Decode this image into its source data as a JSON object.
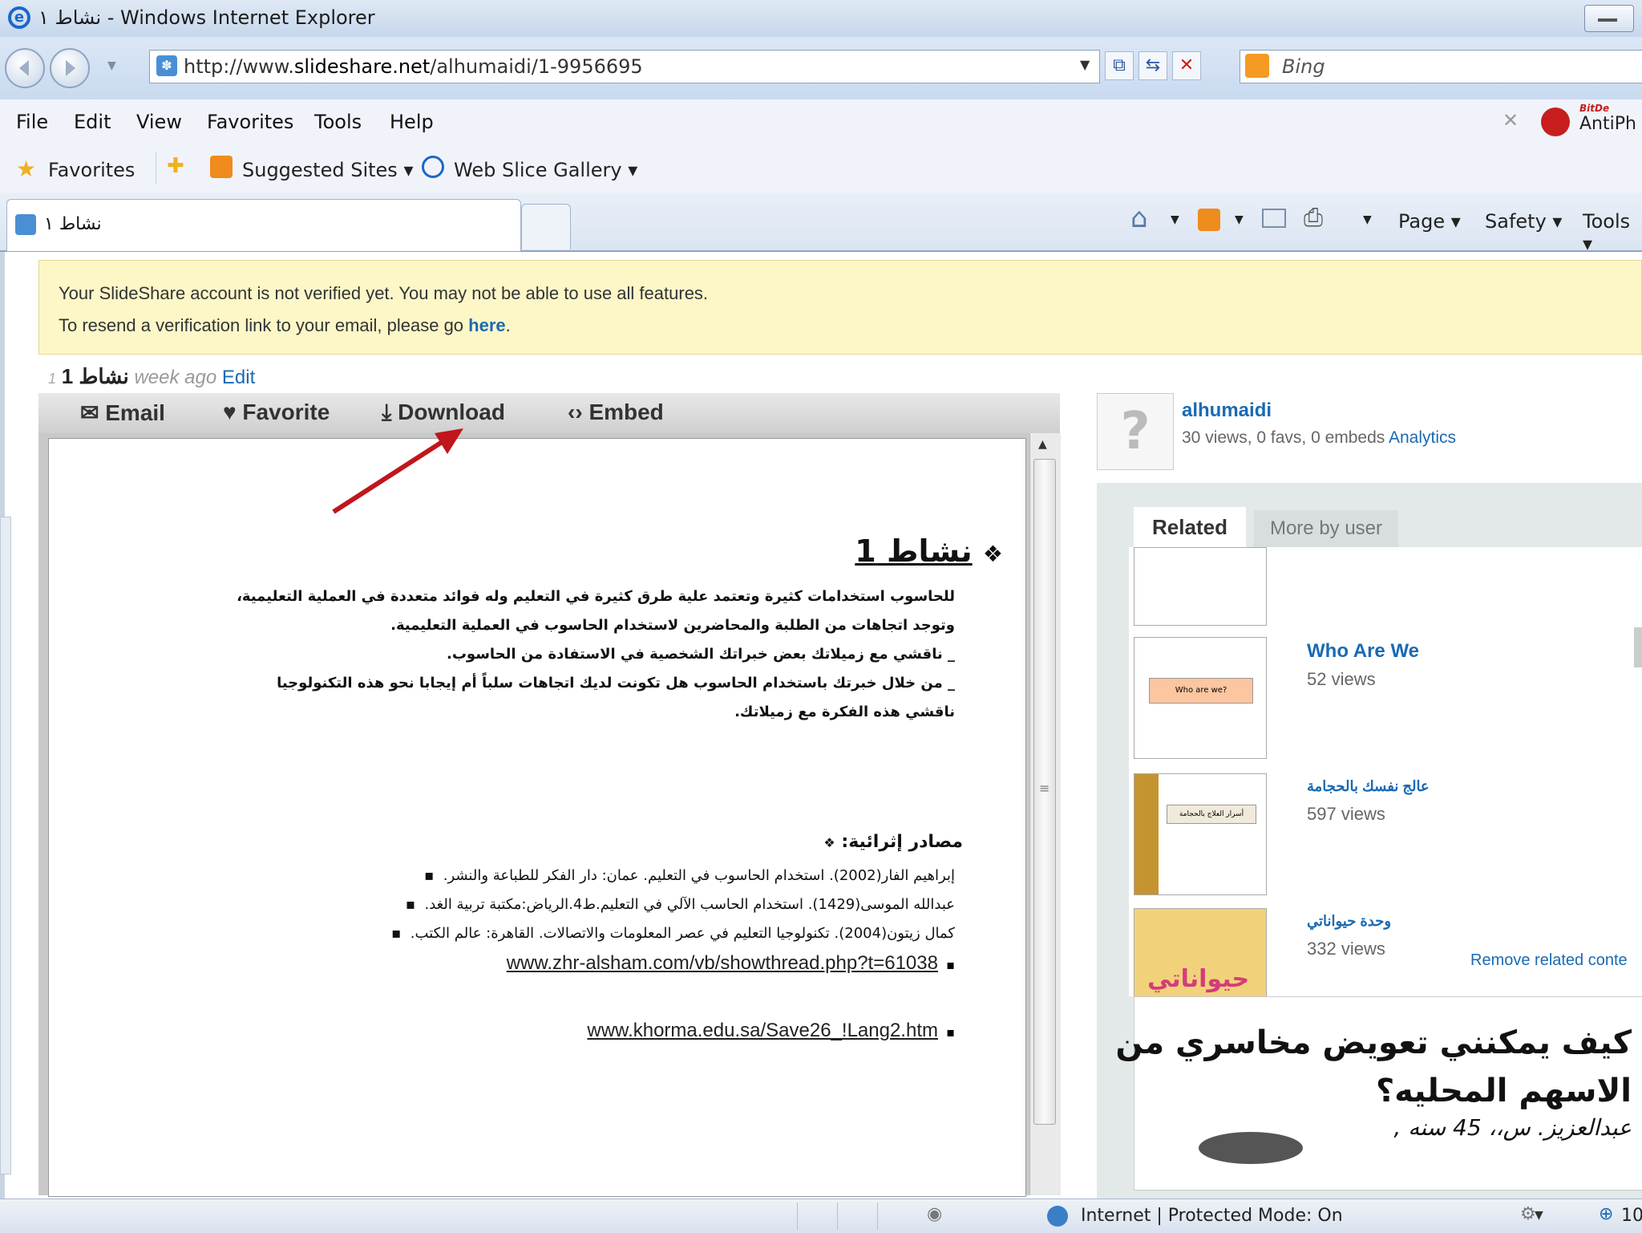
{
  "window": {
    "title": "نشاط ١ - Windows Internet Explorer"
  },
  "navbar": {
    "url_prefix": "http://www.",
    "url_domain": "slideshare.net",
    "url_path": "/alhumaidi/1-9956695",
    "search_placeholder": "Bing"
  },
  "menu": [
    "File",
    "Edit",
    "View",
    "Favorites",
    "Tools",
    "Help"
  ],
  "antiphishing": "AntiPh",
  "antiphishing_brand": "BitDe",
  "favorites": {
    "label": "Favorites",
    "suggested": "Suggested Sites",
    "webslice": "Web Slice Gallery"
  },
  "tab": {
    "title": "نشاط ١"
  },
  "commandbar": {
    "page": "Page",
    "safety": "Safety",
    "tools": "Tools"
  },
  "notice": {
    "line1": "Your SlideShare account is not verified yet. You may not be able to use all features.",
    "line2_pre": "To resend a verification link to your email, please go ",
    "link": "here",
    "line2_post": "."
  },
  "slide_header": {
    "title": "نشاط 1",
    "age": "week ago",
    "edit": "Edit"
  },
  "actions": {
    "email": "Email",
    "favorite": "Favorite",
    "download": "Download",
    "embed": "Embed"
  },
  "slide": {
    "heading": "نشاط 1",
    "para1": "للحاسوب استخدامات كثيرة وتعتمد علية طرق كثيرة في التعليم وله فوائد متعددة في العملية التعليمية،",
    "para2": "وتوجد اتجاهات من الطلبة والمحاضرين لاستخدام الحاسوب في العملية التعليمية.",
    "item1": "_ ناقشي مع زميلاتك بعض خبراتك الشخصية في الاستفادة من الحاسوب.",
    "item2": "_ من خلال خبرتك باستخدام الحاسوب هل تكونت لديك اتجاهات سلباً أم إيجابا نحو هذه التكنولوجيا",
    "item3": "ناقشي هذه الفكرة مع زميلاتك.",
    "refs_title": "مصادر إثرائية:",
    "refs": [
      "إبراهيم الفار(2002). استخدام الحاسوب في التعليم. عمان: دار الفكر للطباعة والنشر.",
      "عبدالله الموسى(1429). استخدام الحاسب الآلي في التعليم.ط4.الرياض:مكتبة تربية الغد.",
      "كمال زيتون(2004). تكنولوجيا التعليم في عصر المعلومات والاتصالات. القاهرة: عالم الكتب."
    ],
    "link1": "www.zhr-alsham.com/vb/showthread.php?t=61038",
    "link2": "www.khorma.edu.sa/Save26_!Lang2.htm"
  },
  "owner": {
    "name": "alhumaidi",
    "stats": "30 views, 0 favs, 0 embeds",
    "analytics": "Analytics"
  },
  "related": {
    "tabs": [
      "Related",
      "More by user"
    ],
    "items": [
      {
        "title": "Who Are We",
        "views": "52 views"
      },
      {
        "title": "عالج نفسك بالحجامة",
        "views": "597 views"
      },
      {
        "title": "وحدة حيواناتي",
        "views": "332 views"
      }
    ],
    "remove": "Remove related conte",
    "thumb_texts": {
      "who": "Who are we?",
      "hijama": "أسرار العلاج بالحجامة",
      "animals": "حيواناتي"
    }
  },
  "ad": {
    "line1": "كيف يمكنني تعويض مخاسري من",
    "line2": "الاسهم المحليه؟",
    "line3": "عبدالعزيز. س،، 45 سنه ,"
  },
  "status": {
    "zone": "Internet | Protected Mode: On",
    "zoom": "10"
  }
}
